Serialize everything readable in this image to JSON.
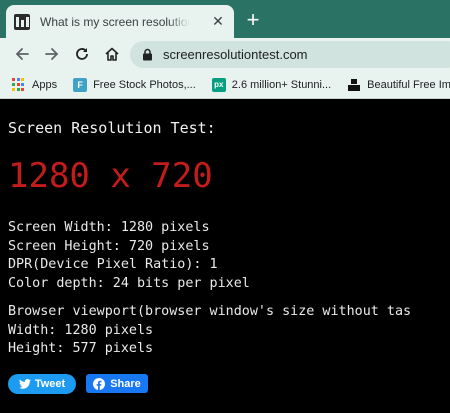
{
  "browser": {
    "tab": {
      "title": "What is my screen resolution - C",
      "close_glyph": "✕"
    },
    "new_tab_glyph": "+",
    "address_bar": {
      "url": "screenresolutiontest.com"
    },
    "bookmarks": [
      {
        "label": "Apps",
        "icon": "apps-grid-icon"
      },
      {
        "label": "Free Stock Photos,...",
        "icon": "free-stock-icon"
      },
      {
        "label": "2.6 million+ Stunni...",
        "icon": "pixabay-icon"
      },
      {
        "label": "Beautiful Free Ima",
        "icon": "unsplash-icon"
      }
    ],
    "theme_color": "#2a7263",
    "toolbar_color": "#e8f2ef"
  },
  "page": {
    "title": "Screen Resolution Test:",
    "resolution": "1280 x 720",
    "resolution_color": "#c41b1b",
    "details": {
      "width": "Screen Width: 1280 pixels",
      "height": "Screen Height: 720 pixels",
      "dpr": "DPR(Device Pixel Ratio): 1",
      "color_depth": "Color depth: 24 bits per pixel"
    },
    "viewport": {
      "heading": "Browser viewport(browser window's size without tas",
      "width": "Width: 1280 pixels",
      "height": "Height: 577 pixels"
    },
    "share": {
      "tweet_label": "Tweet",
      "facebook_label": "Share"
    }
  }
}
